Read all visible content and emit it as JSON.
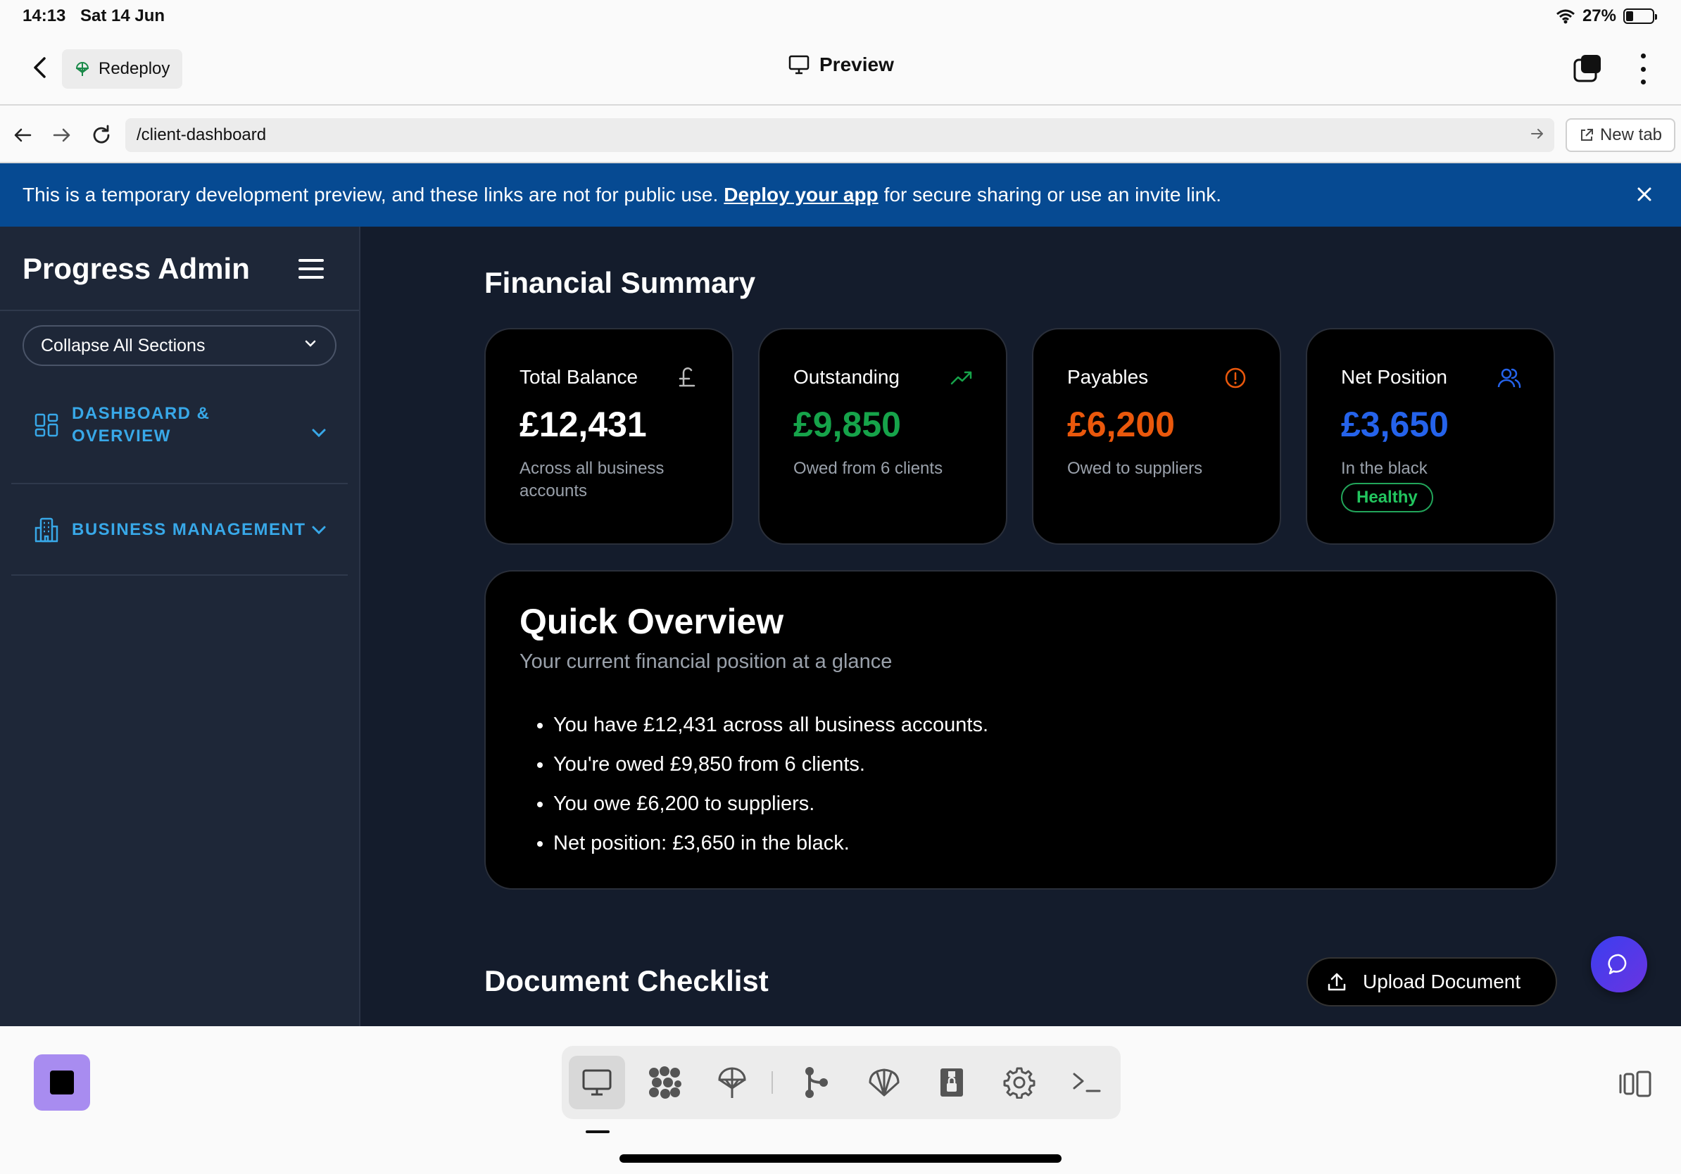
{
  "status": {
    "time": "14:13",
    "date": "Sat 14 Jun",
    "battery": "27%",
    "battery_level": 0.27
  },
  "appbar": {
    "redeploy_label": "Redeploy",
    "title": "Preview"
  },
  "urlbar": {
    "url": "/client-dashboard",
    "new_tab_label": "New tab"
  },
  "banner": {
    "text_before": "This is a temporary development preview, and these links are not for public use.",
    "link": "Deploy your app",
    "text_after": "for secure sharing or use an invite link."
  },
  "sidebar": {
    "title": "Progress Admin",
    "collapse_label": "Collapse All Sections",
    "sections": [
      {
        "label_line1": "DASHBOARD &",
        "label_line2": "OVERVIEW"
      },
      {
        "label": "BUSINESS MANAGEMENT"
      }
    ]
  },
  "main": {
    "financial_title": "Financial Summary",
    "cards": [
      {
        "title": "Total Balance",
        "value": "£12,431",
        "sub": "Across all business accounts",
        "icon": "pound-icon",
        "color": "#ffffff"
      },
      {
        "title": "Outstanding",
        "value": "£9,850",
        "sub": "Owed from 6 clients",
        "icon": "trending-up-icon",
        "color": "#16a34a"
      },
      {
        "title": "Payables",
        "value": "£6,200",
        "sub": "Owed to suppliers",
        "icon": "alert-circle-icon",
        "color": "#ea580c"
      },
      {
        "title": "Net Position",
        "value": "£3,650",
        "sub": "In the black",
        "badge": "Healthy",
        "icon": "users-icon",
        "color": "#2563eb"
      }
    ],
    "overview": {
      "title": "Quick Overview",
      "subtitle": "Your current financial position at a glance",
      "items": [
        "You have £12,431 across all business accounts.",
        "You're owed £9,850 from 6 clients.",
        "You owe £6,200 to suppliers.",
        "Net position: £3,650 in the black."
      ]
    },
    "document_title": "Document Checklist",
    "upload_label": "Upload Document"
  },
  "dock": {
    "items": [
      "monitor-icon",
      "apps-icon",
      "deploy-icon",
      "git-icon",
      "shell-icon",
      "secrets-icon",
      "settings-icon",
      "terminal-icon"
    ]
  },
  "colors": {
    "banner": "#064a92",
    "sidebar": "#1e2738",
    "main_bg": "#141c2c",
    "accent": "#38a8e8",
    "purple": "#a88cf0"
  }
}
